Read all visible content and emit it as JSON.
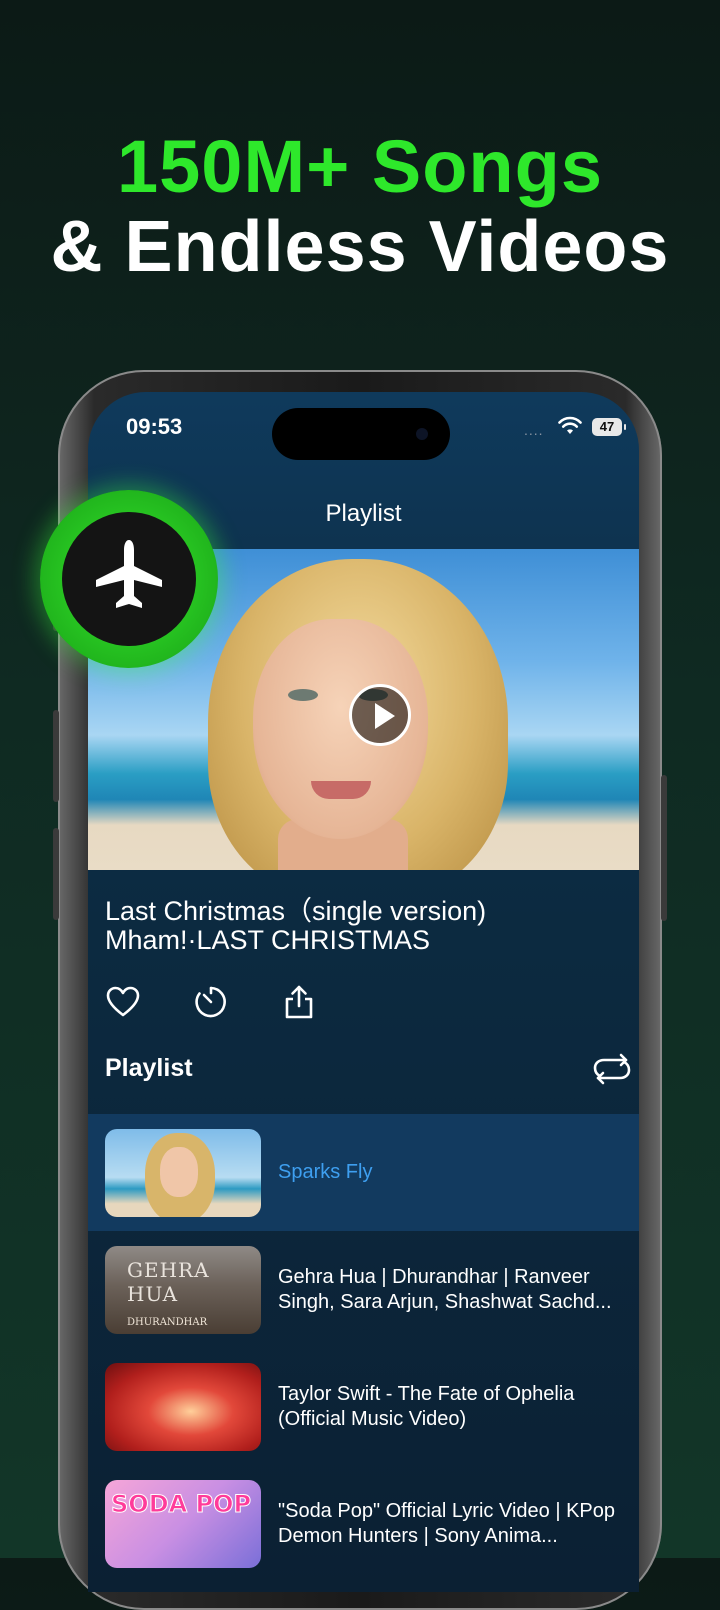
{
  "promo": {
    "headline_line1": "150M+ Songs",
    "headline_line2": "& Endless Videos",
    "accent_color": "#2ee82b"
  },
  "status_bar": {
    "time": "09:53",
    "signal": "....",
    "battery": "47"
  },
  "screen": {
    "title": "Playlist"
  },
  "now_playing": {
    "title": "Last Christmas（single version)",
    "artist": "Mham!·LAST CHRISTMAS",
    "actions": [
      "heart-icon",
      "timer-icon",
      "share-icon"
    ]
  },
  "playlist": {
    "header": "Playlist",
    "loop_icon": "loop-icon",
    "items": [
      {
        "title": "Sparks Fly",
        "active": true
      },
      {
        "title": "Gehra Hua | Dhurandhar | Ranveer Singh, Sara Arjun, Shashwat Sachd...",
        "thumb_text": "GEHRA HUA",
        "thumb_subtext": "DHURANDHAR"
      },
      {
        "title": "Taylor Swift - The Fate of Ophelia (Official Music Video)"
      },
      {
        "title": "\"Soda Pop\" Official Lyric Video | KPop Demon Hunters | Sony Anima...",
        "thumb_text": "SODA POP"
      }
    ],
    "active_color": "#3e9ff0"
  },
  "badge": {
    "icon": "airplane-icon"
  }
}
